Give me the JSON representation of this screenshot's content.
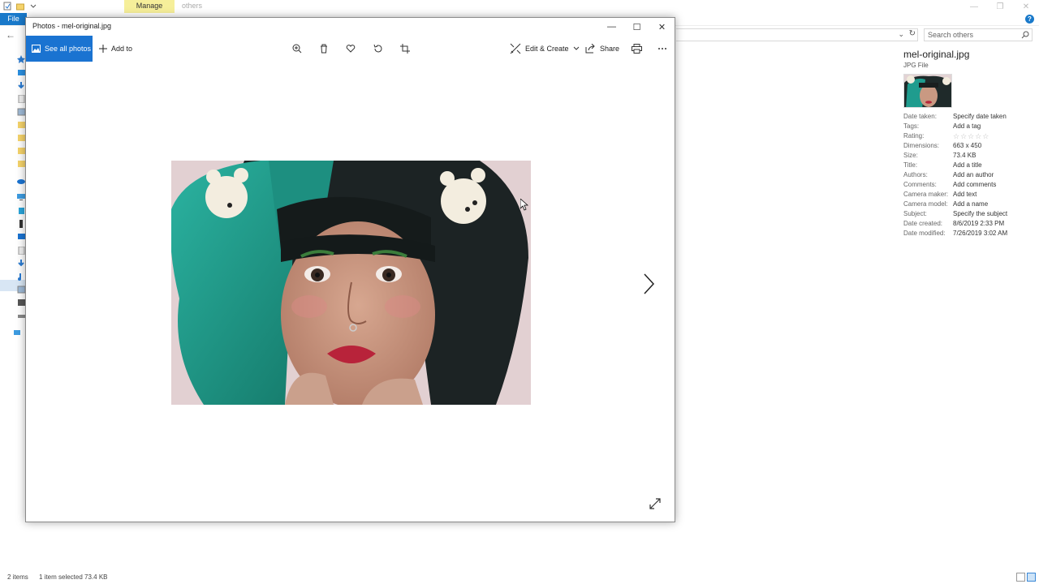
{
  "explorer": {
    "ribbon": {
      "file_tab": "File",
      "manage_tab": "Manage",
      "window_title": "others"
    },
    "search": {
      "placeholder": "Search others"
    },
    "details": {
      "file_name": "mel-original.jpg",
      "file_type": "JPG File",
      "properties": [
        {
          "key": "Date taken:",
          "value": "Specify date taken"
        },
        {
          "key": "Tags:",
          "value": "Add a tag"
        },
        {
          "key": "Rating:",
          "value": "☆☆☆☆☆"
        },
        {
          "key": "Dimensions:",
          "value": "663 x 450"
        },
        {
          "key": "Size:",
          "value": "73.4 KB"
        },
        {
          "key": "Title:",
          "value": "Add a title"
        },
        {
          "key": "Authors:",
          "value": "Add an author"
        },
        {
          "key": "Comments:",
          "value": "Add comments"
        },
        {
          "key": "Camera maker:",
          "value": "Add text"
        },
        {
          "key": "Camera model:",
          "value": "Add a name"
        },
        {
          "key": "Subject:",
          "value": "Specify the subject"
        },
        {
          "key": "Date created:",
          "value": "8/6/2019 2:33 PM"
        },
        {
          "key": "Date modified:",
          "value": "7/26/2019 3:02 AM"
        }
      ]
    },
    "status": {
      "item_count": "2 items",
      "selection": "1 item selected  73.4 KB"
    }
  },
  "photos": {
    "title": "Photos - mel-original.jpg",
    "toolbar": {
      "see_all_label": "See all photos",
      "add_to_label": "Add to",
      "edit_create_label": "Edit & Create",
      "share_label": "Share",
      "icons": [
        "zoom-icon",
        "delete-icon",
        "favorite-icon",
        "rotate-icon",
        "crop-icon",
        "print-icon",
        "more-icon"
      ]
    }
  },
  "colors": {
    "accent": "#1a73d1",
    "manage_tab": "#f6ef9a",
    "file_tab": "#1979ca"
  }
}
